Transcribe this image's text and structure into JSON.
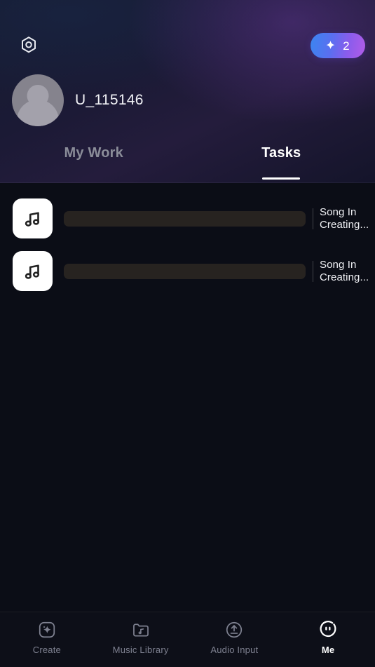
{
  "header": {
    "settings_icon": "settings-hexagon-icon",
    "credits": {
      "icon": "sparkle-icon",
      "count": "2"
    },
    "profile": {
      "avatar_icon": "default-user-avatar",
      "username": "U_115146"
    }
  },
  "tabs": [
    {
      "label": "My Work",
      "active": false
    },
    {
      "label": "Tasks",
      "active": true
    }
  ],
  "tasks": [
    {
      "thumb_icon": "music-note-icon",
      "title_placeholder": "",
      "status": "Song In Creating..."
    },
    {
      "thumb_icon": "music-note-icon",
      "title_placeholder": "",
      "status": "Song In Creating..."
    }
  ],
  "bottom_nav": [
    {
      "label": "Create",
      "icon": "sparkle-square-icon",
      "active": false
    },
    {
      "label": "Music Library",
      "icon": "folder-music-icon",
      "active": false
    },
    {
      "label": "Audio Input",
      "icon": "upload-circle-icon",
      "active": false
    },
    {
      "label": "Me",
      "icon": "profile-face-icon",
      "active": true
    }
  ],
  "colors": {
    "background": "#0b0d16",
    "header_gradient_start": "#161d33",
    "header_gradient_end": "#14142a",
    "accent_blue": "#3a86f0",
    "accent_purple": "#b35ce8",
    "active_text": "#ffffff",
    "inactive_text": "#7e8190",
    "skeleton": "#272320"
  }
}
